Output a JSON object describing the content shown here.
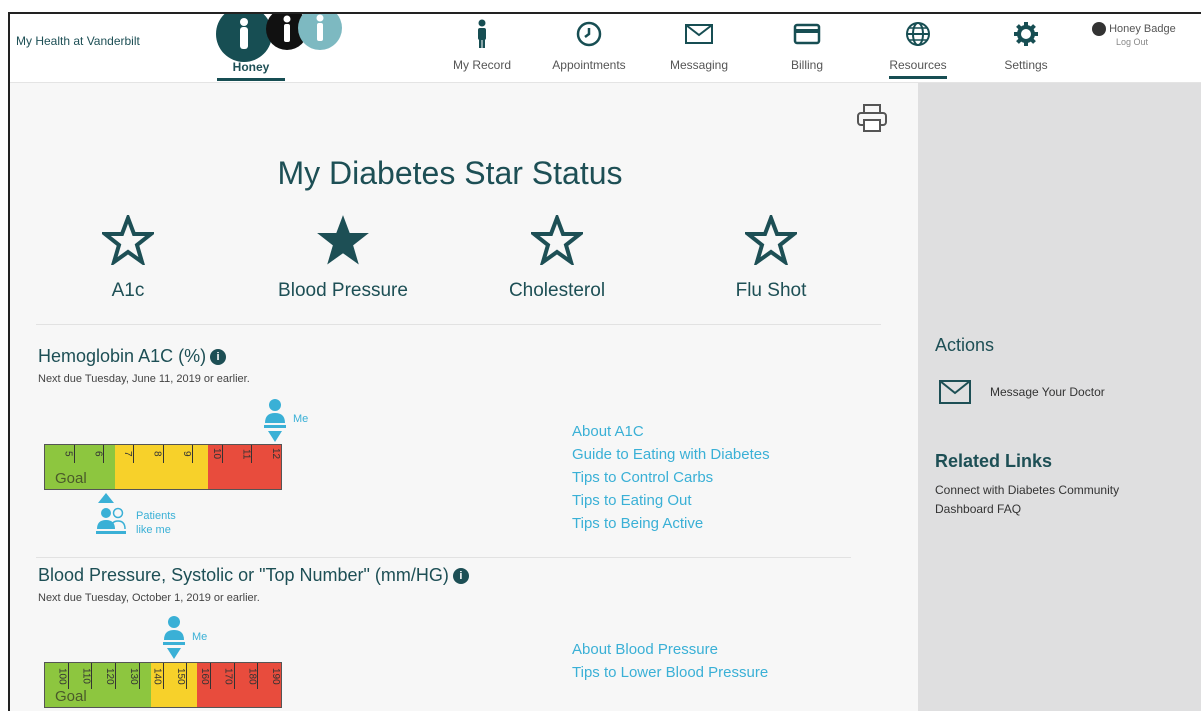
{
  "header": {
    "brand": "My Health at Vanderbilt",
    "active_person": "Honey",
    "nav": [
      {
        "label": "My Record",
        "icon": "person-icon"
      },
      {
        "label": "Appointments",
        "icon": "clock-icon"
      },
      {
        "label": "Messaging",
        "icon": "envelope-icon"
      },
      {
        "label": "Billing",
        "icon": "card-icon"
      },
      {
        "label": "Resources",
        "icon": "globe-icon"
      },
      {
        "label": "Settings",
        "icon": "gear-icon"
      }
    ],
    "user_name": "Honey Badge",
    "logout": "Log Out"
  },
  "main": {
    "title": "My Diabetes Star Status",
    "stars": [
      {
        "label": "A1c",
        "filled": false
      },
      {
        "label": "Blood Pressure",
        "filled": true
      },
      {
        "label": "Cholesterol",
        "filled": false
      },
      {
        "label": "Flu Shot",
        "filled": false
      }
    ],
    "a1c": {
      "title": "Hemoglobin A1C (%)",
      "info": "i",
      "due": "Next due Tuesday, June 11, 2019 or earlier.",
      "ticks": [
        "5",
        "6",
        "7",
        "8",
        "9",
        "10",
        "11",
        "12"
      ],
      "goal": "Goal",
      "me_label": "Me",
      "patients_label": [
        "Patients",
        "like me"
      ],
      "links": [
        "About A1C",
        "Guide to Eating with Diabetes",
        "Tips to Control Carbs",
        "Tips to Eating Out",
        "Tips to Being Active"
      ]
    },
    "bp": {
      "title": "Blood Pressure, Systolic or \"Top Number\" (mm/HG)",
      "info": "i",
      "due": "Next due Tuesday, October 1, 2019 or earlier.",
      "ticks": [
        "100",
        "110",
        "120",
        "130",
        "140",
        "150",
        "160",
        "170",
        "180",
        "190"
      ],
      "goal": "Goal",
      "me_label": "Me",
      "links": [
        "About Blood Pressure",
        "Tips to Lower Blood Pressure"
      ]
    }
  },
  "sidebar": {
    "actions_heading": "Actions",
    "message_doctor": "Message Your Doctor",
    "related_heading": "Related Links",
    "related": [
      "Connect with Diabetes Community",
      "Dashboard FAQ"
    ]
  },
  "colors": {
    "primary": "#174e53",
    "link": "#3ab0d6",
    "green": "#8dc63f",
    "yellow": "#f7d12a",
    "red": "#e84c3d"
  }
}
